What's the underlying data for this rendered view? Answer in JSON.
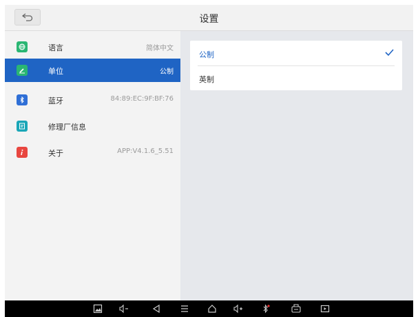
{
  "header": {
    "title": "设置"
  },
  "sidebar": {
    "items": [
      {
        "label": "语言",
        "value": "简体中文",
        "icon": "globe-icon",
        "color": "#2ab673"
      },
      {
        "label": "单位",
        "value": "公制",
        "icon": "ruler-icon",
        "color": "#2ab673"
      },
      {
        "label": "蓝牙",
        "value": "84:89:EC:9F:BF:76",
        "icon": "bluetooth-icon",
        "color": "#2f6fd6"
      },
      {
        "label": "修理厂信息",
        "value": "",
        "icon": "document-icon",
        "color": "#1aa6b7"
      },
      {
        "label": "关于",
        "value": "APP:V4.1.6_5.51",
        "icon": "info-icon",
        "color": "#e8463f"
      }
    ]
  },
  "main": {
    "options": [
      {
        "label": "公制",
        "selected": true
      },
      {
        "label": "英制",
        "selected": false
      }
    ]
  },
  "navbar": {
    "icons": [
      "screenshot-icon",
      "volume-down-icon",
      "back-icon",
      "menu-icon",
      "home-icon",
      "volume-up-icon",
      "bluetooth-icon",
      "vci-icon",
      "screen-record-icon"
    ]
  },
  "colors": {
    "accent": "#1f64c4",
    "check": "#1f64c4"
  }
}
